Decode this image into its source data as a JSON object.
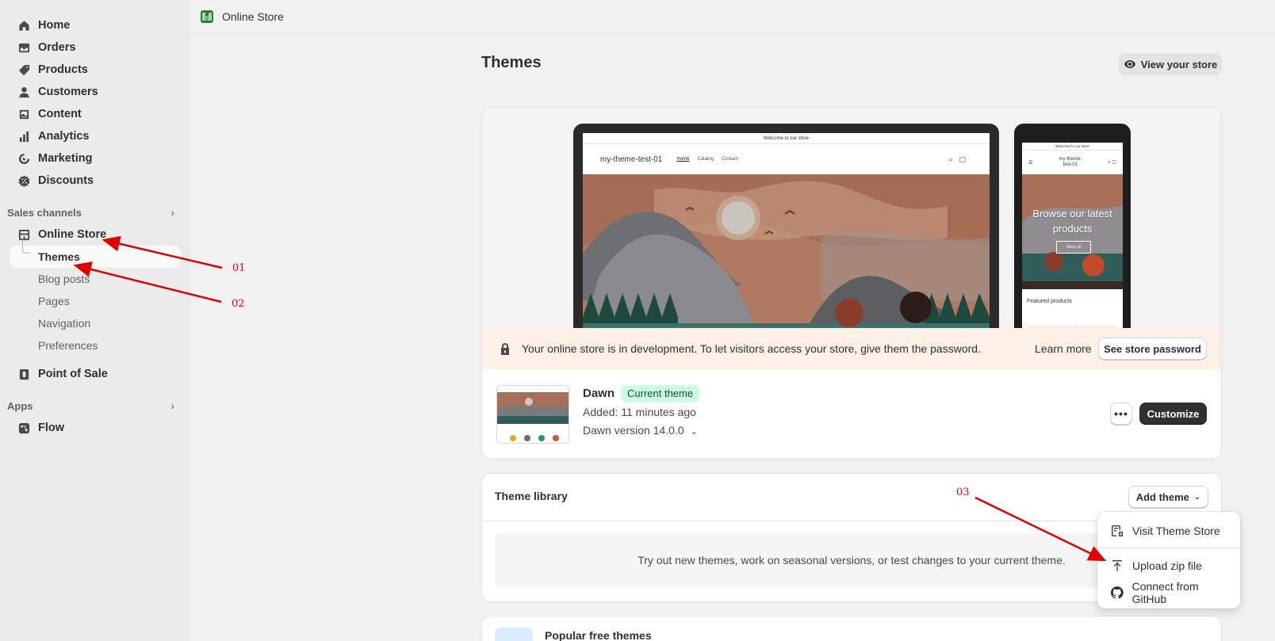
{
  "sidebar": {
    "items": [
      {
        "label": "Home",
        "icon": "home-icon"
      },
      {
        "label": "Orders",
        "icon": "inbox-icon"
      },
      {
        "label": "Products",
        "icon": "tag-icon"
      },
      {
        "label": "Customers",
        "icon": "person-icon"
      },
      {
        "label": "Content",
        "icon": "image-icon"
      },
      {
        "label": "Analytics",
        "icon": "bar-chart-icon"
      },
      {
        "label": "Marketing",
        "icon": "target-icon"
      },
      {
        "label": "Discounts",
        "icon": "discount-icon"
      }
    ],
    "sales_channels_label": "Sales channels",
    "online_store_label": "Online Store",
    "online_store_sub": [
      "Themes",
      "Blog posts",
      "Pages",
      "Navigation",
      "Preferences"
    ],
    "pos_label": "Point of Sale",
    "apps_label": "Apps",
    "flow_label": "Flow"
  },
  "topbar": {
    "title": "Online Store"
  },
  "page": {
    "title": "Themes",
    "view_store": "View your store"
  },
  "preview": {
    "desktop": {
      "announcement": "Welcome to our store",
      "brand": "my-theme-test-01",
      "links": [
        "Home",
        "Catalog",
        "Contact"
      ]
    },
    "mobile": {
      "announcement": "Welcome to our store",
      "brand_line1": "my-theme-",
      "brand_line2": "test-01",
      "hero_text": "Browse our latest products",
      "button": "Shop all",
      "featured": "Featured products"
    }
  },
  "banner": {
    "message": "Your online store is in development. To let visitors access your store, give them the password.",
    "learn_more": "Learn more",
    "button": "See store password"
  },
  "current_theme": {
    "name": "Dawn",
    "badge": "Current theme",
    "added": "Added: 11 minutes ago",
    "version": "Dawn version 14.0.0",
    "more": "•••",
    "customize": "Customize"
  },
  "library": {
    "title": "Theme library",
    "add_theme": "Add theme",
    "empty_text": "Try out new themes, work on seasonal versions, or test changes to your current theme."
  },
  "popular": {
    "title": "Popular free themes"
  },
  "dropdown": {
    "items": [
      "Visit Theme Store",
      "Upload zip file",
      "Connect from GitHub"
    ]
  },
  "annotations": {
    "labels": [
      "01",
      "02",
      "03"
    ],
    "color": "#e00000"
  },
  "colors": {
    "sidebar_bg": "#ebebeb",
    "page_bg": "#f1f1f1",
    "banner_bg": "#fdf1e7",
    "badge_bg": "#cdfee1",
    "primary_button": "#303030"
  }
}
